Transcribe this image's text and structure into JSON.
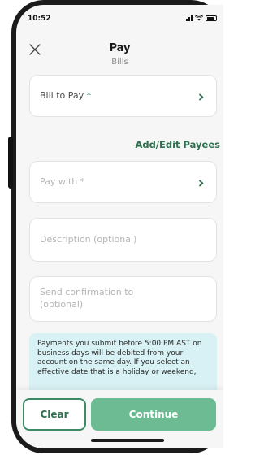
{
  "status": {
    "time": "10:52"
  },
  "header": {
    "title": "Pay",
    "subtitle": "Bills"
  },
  "form": {
    "bill_to_pay": {
      "label": "Bill to Pay",
      "required_mark": "*"
    },
    "add_edit_payees": "Add/Edit Payees",
    "pay_with": {
      "label": "Pay with",
      "required_mark": "*"
    },
    "description": {
      "placeholder": "Description (optional)"
    },
    "confirmation": {
      "placeholder": "Send confirmation to (optional)"
    }
  },
  "notice": {
    "text": "Payments you submit before 5:00 PM AST on business days will be debited from your account on the same day. If you select an effective date that is a holiday or weekend,"
  },
  "footer": {
    "clear_label": "Clear",
    "continue_label": "Continue"
  },
  "icons": {
    "close": "close-icon",
    "chevron": "chevron-right-icon"
  },
  "colors": {
    "accent_green": "#2e6f4e",
    "continue_button": "#6dbb92",
    "notice_background": "#d8f1f4"
  }
}
